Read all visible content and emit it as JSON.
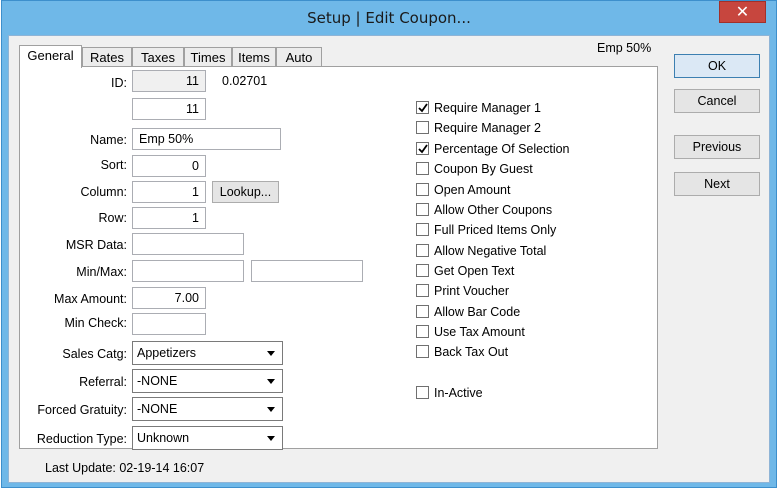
{
  "window": {
    "title": "Setup | Edit Coupon...",
    "close_glyph": "✕"
  },
  "tabs": [
    "General",
    "Rates",
    "Taxes",
    "Times",
    "Items",
    "Auto"
  ],
  "header_right": "Emp 50%",
  "buttons": {
    "ok": "OK",
    "cancel": "Cancel",
    "previous": "Previous",
    "next": "Next",
    "lookup": "Lookup..."
  },
  "form": {
    "id_label": "ID:",
    "id_value": "11",
    "id_extra": "0.02701",
    "id2_value": "11",
    "name_label": "Name:",
    "name_value": "Emp 50%",
    "sort_label": "Sort:",
    "sort_value": "0",
    "column_label": "Column:",
    "column_value": "1",
    "row_label": "Row:",
    "row_value": "1",
    "msr_label": "MSR Data:",
    "msr_value": "",
    "minmax_label": "Min/Max:",
    "min_value": "",
    "max_value": "",
    "max_amount_label": "Max Amount:",
    "max_amount_value": "7.00",
    "min_check_label": "Min Check:",
    "min_check_value": "",
    "sales_catg_label": "Sales Catg:",
    "sales_catg_value": "Appetizers",
    "referral_label": "Referral:",
    "referral_value": "-NONE",
    "forced_gratuity_label": "Forced Gratuity:",
    "forced_gratuity_value": "-NONE",
    "reduction_type_label": "Reduction Type:",
    "reduction_type_value": "Unknown"
  },
  "options": [
    {
      "label": "Require Manager 1",
      "checked": true
    },
    {
      "label": "Require Manager 2",
      "checked": false
    },
    {
      "label": "Percentage Of Selection",
      "checked": true
    },
    {
      "label": "Coupon By Guest",
      "checked": false
    },
    {
      "label": "Open Amount",
      "checked": false
    },
    {
      "label": "Allow Other Coupons",
      "checked": false
    },
    {
      "label": "Full Priced Items Only",
      "checked": false
    },
    {
      "label": "Allow Negative Total",
      "checked": false
    },
    {
      "label": "Get Open Text",
      "checked": false
    },
    {
      "label": "Print Voucher",
      "checked": false
    },
    {
      "label": "Allow Bar Code",
      "checked": false
    },
    {
      "label": "Use Tax Amount",
      "checked": false
    },
    {
      "label": "Back Tax Out",
      "checked": false
    }
  ],
  "inactive": {
    "label": "In-Active",
    "checked": false
  },
  "footer": {
    "last_update": "Last Update: 02-19-14 16:07"
  },
  "colors": {
    "titlebar": "#6fb8e8",
    "close": "#c7463e",
    "client": "#f0f0f0"
  }
}
